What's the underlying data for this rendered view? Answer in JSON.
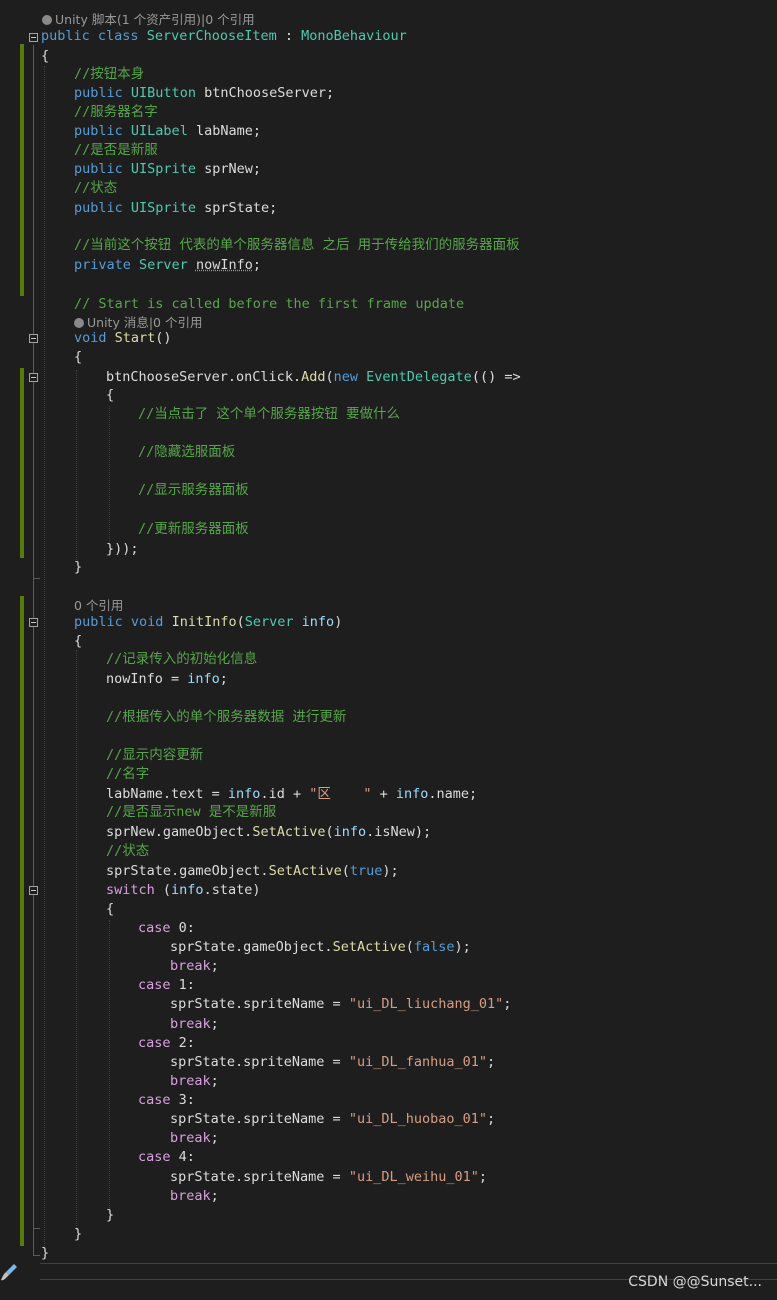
{
  "codelens": {
    "class_lens_prefix": "Unity 脚本(1 个资产引用)",
    "class_lens_refs": "|0 个引用",
    "start_lens_prefix": "Unity 消息",
    "start_lens_refs": "|0 个引用",
    "initinfo_refs": "0 个引用"
  },
  "code": {
    "class_kw_public": "public",
    "class_kw_class": "class",
    "class_name": "ServerChooseItem",
    "class_colon": " : ",
    "base_class": "MonoBehaviour",
    "brace_open": "{",
    "brace_close": "}",
    "c_button": "//按钮本身",
    "f_btn_type": "UIButton",
    "f_btn_name": " btnChooseServer;",
    "c_name": "//服务器名字",
    "f_lab_type": "UILabel",
    "f_lab_name": " labName;",
    "c_isnew": "//是否是新服",
    "f_new_type": "UISprite",
    "f_new_name": " sprNew;",
    "c_state": "//状态",
    "f_state_type": "UISprite",
    "f_state_name": " sprState;",
    "c_current": "//当前这个按钮 代表的单个服务器信息 之后 用于传给我们的服务器面板",
    "kw_private": "private",
    "f_info_type": "Server",
    "f_info_name": "nowInfo",
    "semicolon": ";",
    "c_start": "// Start is called before the first frame update",
    "kw_void": "void",
    "m_start": "Start",
    "parens": "()",
    "l_onclick_obj": "btnChooseServer.",
    "l_onclick_prop": "onClick.",
    "l_add": "Add",
    "l_paren": "(",
    "kw_new": "new",
    "l_delegate": "EventDelegate",
    "l_lambda": "(() =>",
    "c_clicked": "//当点击了 这个单个服务器按钮 要做什么",
    "c_hide": "//隐藏选服面板",
    "c_show": "//显示服务器面板",
    "c_update": "//更新服务器面板",
    "l_close_lambda": "}));",
    "m_initinfo": "InitInfo",
    "p_type": "Server",
    "p_name": "info",
    "paren_close": ")",
    "c_record": "//记录传入的初始化信息",
    "l_assign_lhs": "nowInfo = ",
    "c_by_data": "//根据传入的单个服务器数据 进行更新",
    "c_display": "//显示内容更新",
    "c_name2": "//名字",
    "l_labtext": "labName.text = ",
    "l_info": "info",
    "l_id": ".id + ",
    "s_qu": "\"区    \"",
    "l_plus": " + ",
    "l_dotname": ".name;",
    "c_shownew": "//是否显示new 是不是新服",
    "l_sprnew_set": "sprNew.gameObject.",
    "m_setactive": "SetActive",
    "l_isnew": ".isNew);",
    "c_state2": "//状态",
    "l_sprstate_go": "sprState.gameObject.",
    "kw_true": "true",
    "l_close_paren_semi": ");",
    "kw_switch": "switch",
    "l_switch_open": " (",
    "l_state": ".state)",
    "kw_case": "case",
    "case0": " 0:",
    "case1": " 1:",
    "case2": " 2:",
    "case3": " 3:",
    "case4": " 4:",
    "kw_false": "false",
    "kw_break": "break",
    "l_sprite_name": "sprState.spriteName = ",
    "s_liuchang": "\"ui_DL_liuchang_01\"",
    "s_fanhua": "\"ui_DL_fanhua_01\"",
    "s_huobao": "\"ui_DL_huobao_01\"",
    "s_weihu": "\"ui_DL_weihu_01\""
  },
  "watermark": "CSDN @@Sunset...",
  "icons": {
    "unity_icon": "unity-icon",
    "brush_icon": "brush-icon"
  }
}
